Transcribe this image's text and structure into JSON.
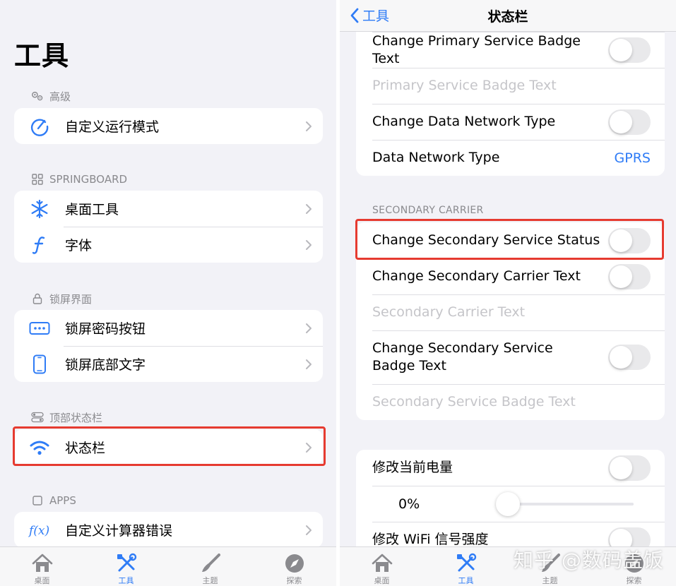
{
  "left": {
    "title": "工具",
    "sections": {
      "advanced": {
        "header": "高级",
        "items": [
          {
            "label": "自定义运行模式",
            "icon": "gauge-icon"
          }
        ]
      },
      "springboard": {
        "header": "SPRINGBOARD",
        "items": [
          {
            "label": "桌面工具",
            "icon": "snowflake-icon"
          },
          {
            "label": "字体",
            "icon": "font-icon"
          }
        ]
      },
      "lockscreen": {
        "header": "锁屏界面",
        "items": [
          {
            "label": "锁屏密码按钮",
            "icon": "dots-icon"
          },
          {
            "label": "锁屏底部文字",
            "icon": "phone-icon"
          }
        ]
      },
      "statusbar": {
        "header": "顶部状态栏",
        "items": [
          {
            "label": "状态栏",
            "icon": "wifi-icon"
          }
        ]
      },
      "apps": {
        "header": "APPS",
        "items": [
          {
            "label": "自定义计算器错误",
            "icon": "function-icon"
          }
        ]
      }
    }
  },
  "right": {
    "back_label": "工具",
    "nav_title": "状态栏",
    "primary": {
      "change_badge_text": "Change Primary Service Badge Text",
      "badge_text_placeholder": "Primary Service Badge Text",
      "change_network_type": "Change Data Network Type",
      "network_type_label": "Data Network Type",
      "network_type_value": "GPRS"
    },
    "secondary": {
      "header": "SECONDARY CARRIER",
      "change_status": "Change Secondary Service Status",
      "change_carrier_text": "Change Secondary Carrier Text",
      "carrier_text_placeholder": "Secondary Carrier Text",
      "change_badge_text": "Change Secondary Service Badge Text",
      "badge_text_placeholder": "Secondary Service Badge Text"
    },
    "battery": {
      "change_battery": "修改当前电量",
      "battery_value": "0%",
      "battery_level": 0,
      "change_wifi": "修改 WiFi 信号强度"
    }
  },
  "tabs": [
    {
      "label": "桌面",
      "icon": "house-icon"
    },
    {
      "label": "工具",
      "icon": "tools-icon",
      "active": true
    },
    {
      "label": "主题",
      "icon": "brush-icon"
    },
    {
      "label": "探索",
      "icon": "compass-icon"
    }
  ],
  "watermark": "知乎 @数码盖饭",
  "colors": {
    "accent": "#2f7cf6",
    "highlight": "#e63b30",
    "background": "#f2f2f7"
  }
}
